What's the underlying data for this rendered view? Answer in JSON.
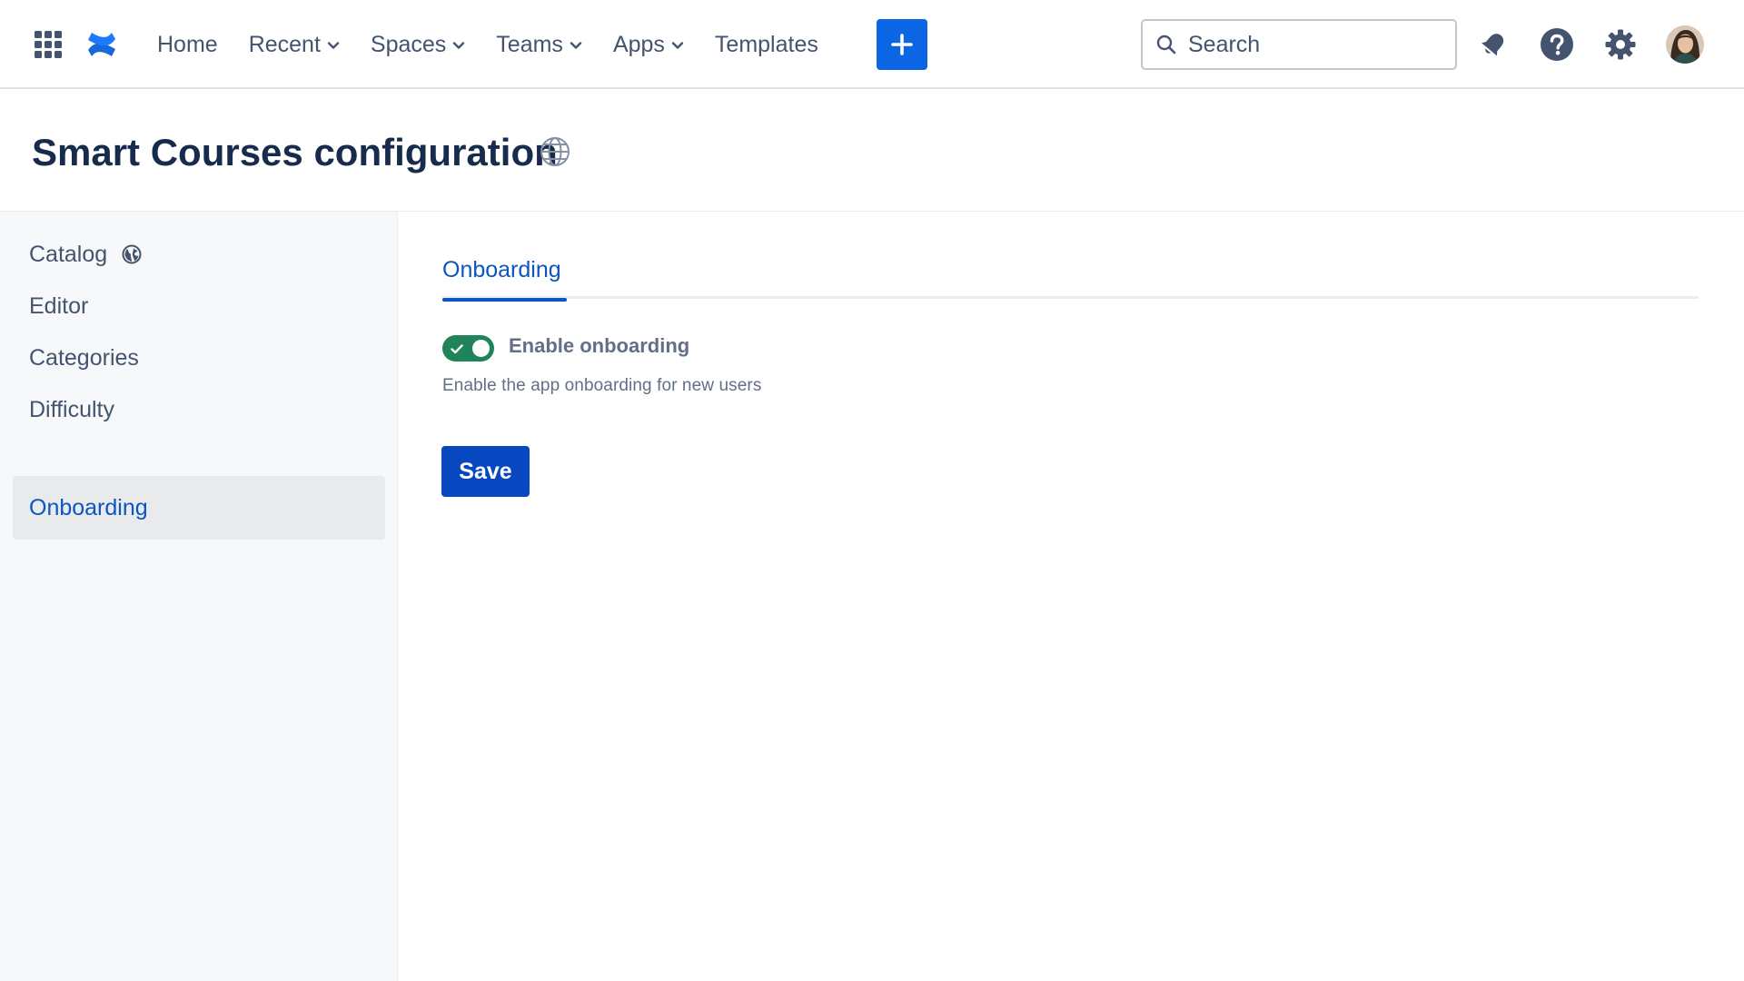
{
  "nav": {
    "items": [
      {
        "label": "Home",
        "dropdown": false
      },
      {
        "label": "Recent",
        "dropdown": true
      },
      {
        "label": "Spaces",
        "dropdown": true
      },
      {
        "label": "Teams",
        "dropdown": true
      },
      {
        "label": "Apps",
        "dropdown": true
      },
      {
        "label": "Templates",
        "dropdown": false
      }
    ],
    "search_placeholder": "Search",
    "icons": [
      "app-switcher-icon",
      "confluence-logo",
      "plus-icon",
      "search-icon",
      "notification-icon",
      "help-icon",
      "settings-icon"
    ]
  },
  "page": {
    "title": "Smart Courses configuration"
  },
  "sidebar": {
    "items": [
      {
        "label": "Catalog",
        "active": false
      },
      {
        "label": "Editor",
        "active": false
      },
      {
        "label": "Categories",
        "active": false
      },
      {
        "label": "Difficulty",
        "active": false
      },
      {
        "label": "Onboarding",
        "active": true
      }
    ]
  },
  "main": {
    "tabs": [
      {
        "label": "Onboarding",
        "active": true
      }
    ],
    "toggle": {
      "label": "Enable onboarding",
      "help": "Enable the app onboarding for new users",
      "checked": true
    },
    "save_label": "Save"
  },
  "colors": {
    "primary": "#0c66e4",
    "link_active": "#0c55c2",
    "toggle_on": "#1f845a",
    "save_button": "#0747c0",
    "text": "#172b4d",
    "subtle_text": "#44546f"
  }
}
